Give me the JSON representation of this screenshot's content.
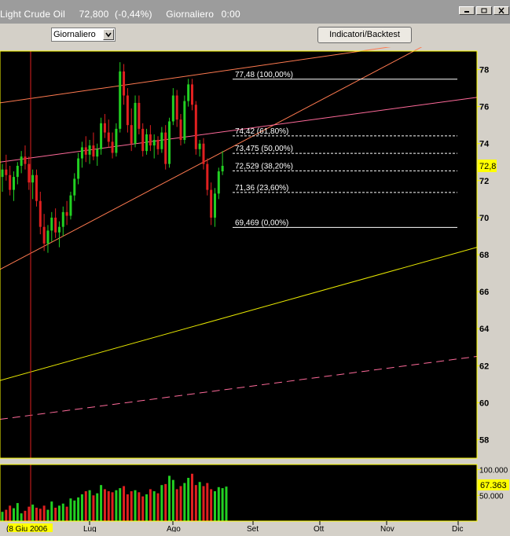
{
  "window": {
    "symbol": "Light Crude Oil",
    "last": "72,800",
    "change": "(-0,44%)",
    "period": "Giornaliero",
    "time": "0:00"
  },
  "toolbar": {
    "period_value": "Giornaliero",
    "indicators_label": "Indicatori/Backtest"
  },
  "chart_data": [
    {
      "type": "bar",
      "title": "",
      "ylim": [
        57,
        79
      ],
      "yticks": [
        "78",
        "76",
        "74",
        "72",
        "70",
        "68",
        "66",
        "64",
        "62",
        "60",
        "58"
      ],
      "last_price_label": "72,8",
      "fibonacci": [
        {
          "price": 77.48,
          "label": "77,48 (100,00%)"
        },
        {
          "price": 74.42,
          "label": "74,42 (61,80%)"
        },
        {
          "price": 73.475,
          "label": "73,475 (50,00%)"
        },
        {
          "price": 72.529,
          "label": "72,529 (38,20%)"
        },
        {
          "price": 71.36,
          "label": "71,36 (23,60%)"
        },
        {
          "price": 69.469,
          "label": "69,469 (0,00%)"
        }
      ],
      "bars": [
        [
          72.2,
          72.9,
          71.4,
          72.6
        ],
        [
          72.6,
          73.4,
          72.0,
          72.3
        ],
        [
          72.3,
          72.8,
          71.2,
          71.5
        ],
        [
          71.5,
          72.5,
          70.9,
          72.2
        ],
        [
          72.2,
          73.0,
          71.8,
          72.8
        ],
        [
          72.8,
          73.6,
          72.4,
          73.3
        ],
        [
          73.3,
          73.9,
          72.6,
          72.9
        ],
        [
          72.9,
          73.3,
          71.5,
          71.9
        ],
        [
          71.9,
          72.6,
          71.0,
          72.3
        ],
        [
          72.3,
          72.6,
          70.6,
          70.9
        ],
        [
          70.9,
          71.4,
          69.1,
          69.5
        ],
        [
          69.5,
          70.2,
          68.2,
          68.6
        ],
        [
          68.6,
          69.6,
          68.1,
          69.3
        ],
        [
          69.3,
          70.3,
          68.7,
          70.0
        ],
        [
          70.0,
          70.5,
          68.9,
          69.2
        ],
        [
          69.2,
          69.8,
          68.4,
          69.5
        ],
        [
          69.5,
          70.6,
          69.0,
          70.3
        ],
        [
          70.3,
          70.9,
          69.6,
          70.1
        ],
        [
          70.1,
          71.4,
          69.9,
          71.2
        ],
        [
          71.2,
          72.4,
          70.9,
          72.1
        ],
        [
          72.1,
          73.5,
          71.8,
          73.2
        ],
        [
          73.2,
          74.1,
          72.7,
          73.8
        ],
        [
          73.8,
          74.4,
          73.0,
          73.4
        ],
        [
          73.4,
          74.2,
          72.9,
          73.9
        ],
        [
          73.9,
          74.6,
          73.1,
          73.3
        ],
        [
          73.3,
          74.0,
          72.8,
          73.7
        ],
        [
          73.7,
          75.4,
          73.4,
          75.1
        ],
        [
          75.1,
          75.6,
          74.3,
          74.6
        ],
        [
          74.6,
          75.3,
          73.8,
          74.1
        ],
        [
          74.1,
          74.6,
          73.2,
          73.5
        ],
        [
          73.5,
          75.1,
          73.3,
          74.8
        ],
        [
          74.8,
          78.4,
          74.6,
          77.9
        ],
        [
          77.9,
          78.3,
          76.1,
          76.6
        ],
        [
          76.6,
          77.0,
          74.6,
          75.0
        ],
        [
          75.0,
          75.9,
          73.6,
          74.0
        ],
        [
          74.0,
          76.6,
          73.8,
          76.2
        ],
        [
          76.2,
          76.6,
          74.5,
          74.8
        ],
        [
          74.8,
          75.1,
          73.3,
          73.6
        ],
        [
          73.6,
          74.8,
          73.4,
          74.5
        ],
        [
          74.5,
          75.0,
          73.6,
          73.9
        ],
        [
          73.9,
          74.5,
          73.2,
          74.2
        ],
        [
          74.2,
          74.4,
          73.4,
          73.7
        ],
        [
          73.7,
          74.9,
          73.5,
          74.6
        ],
        [
          74.6,
          75.0,
          72.6,
          72.9
        ],
        [
          72.9,
          75.4,
          72.7,
          75.2
        ],
        [
          75.2,
          77.0,
          75.0,
          76.6
        ],
        [
          76.6,
          76.9,
          74.9,
          75.3
        ],
        [
          75.3,
          75.6,
          73.9,
          74.2
        ],
        [
          74.2,
          76.6,
          74.0,
          76.3
        ],
        [
          76.3,
          77.5,
          76.0,
          77.2
        ],
        [
          77.2,
          77.5,
          75.8,
          76.1
        ],
        [
          76.1,
          76.3,
          73.4,
          73.7
        ],
        [
          73.7,
          74.2,
          73.3,
          74.0
        ],
        [
          74.0,
          74.3,
          72.6,
          72.9
        ],
        [
          72.9,
          73.2,
          71.2,
          71.5
        ],
        [
          71.5,
          71.9,
          69.6,
          70.0
        ],
        [
          70.0,
          71.6,
          69.5,
          71.3
        ],
        [
          71.3,
          72.7,
          71.0,
          72.5
        ],
        [
          72.5,
          73.6,
          72.3,
          72.8
        ]
      ]
    },
    {
      "type": "bar",
      "title": "",
      "ylim": [
        0,
        110
      ],
      "yticks": [
        "100.000",
        "50.000"
      ],
      "last_value_label": "67.363",
      "values": [
        18,
        22,
        30,
        25,
        35,
        15,
        20,
        28,
        32,
        26,
        24,
        30,
        22,
        38,
        26,
        30,
        34,
        28,
        44,
        40,
        46,
        52,
        58,
        60,
        50,
        54,
        70,
        62,
        58,
        56,
        60,
        64,
        68,
        52,
        58,
        60,
        56,
        48,
        52,
        62,
        58,
        54,
        70,
        72,
        88,
        80,
        62,
        68,
        74,
        84,
        92,
        70,
        76,
        68,
        74,
        62,
        58,
        66,
        64,
        67
      ]
    }
  ],
  "xaxis": {
    "labels": [
      "(8 Giu 2006",
      "Lug",
      "Ago",
      "Set",
      "Ott",
      "Nov",
      "Dic"
    ]
  }
}
